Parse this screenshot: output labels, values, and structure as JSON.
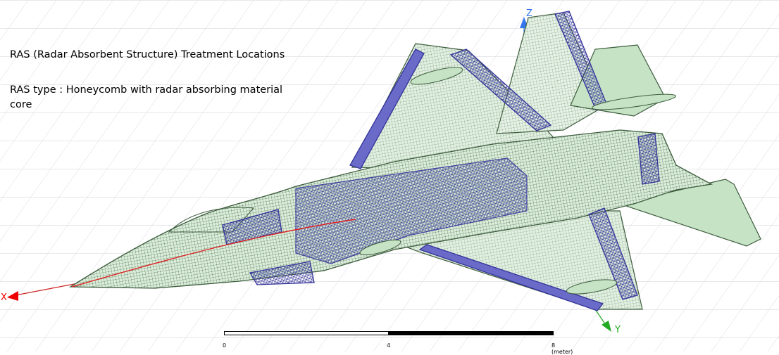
{
  "annotations": {
    "title": "RAS (Radar Absorbent Structure) Treatment Locations",
    "ras_type": "RAS type : Honeycomb with radar absorbing material\ncore"
  },
  "axes": {
    "x_label": "X",
    "y_label": "Y",
    "z_label": "Z",
    "x_color": "#ff0000",
    "y_color": "#22aa22",
    "z_color": "#3377ee"
  },
  "scale_bar": {
    "tick_start": "0",
    "tick_mid": "4",
    "tick_end": "8 (meter)"
  },
  "colors": {
    "background": "#ffffff",
    "grid": "#d5d5dc",
    "wireframe": "#3d5c3d",
    "surface_fill": "#cfe8cf",
    "ras_highlight": "#333399",
    "centerline": "#dd2222"
  },
  "model": {
    "icons": [
      "aircraft-wireframe-model"
    ]
  }
}
